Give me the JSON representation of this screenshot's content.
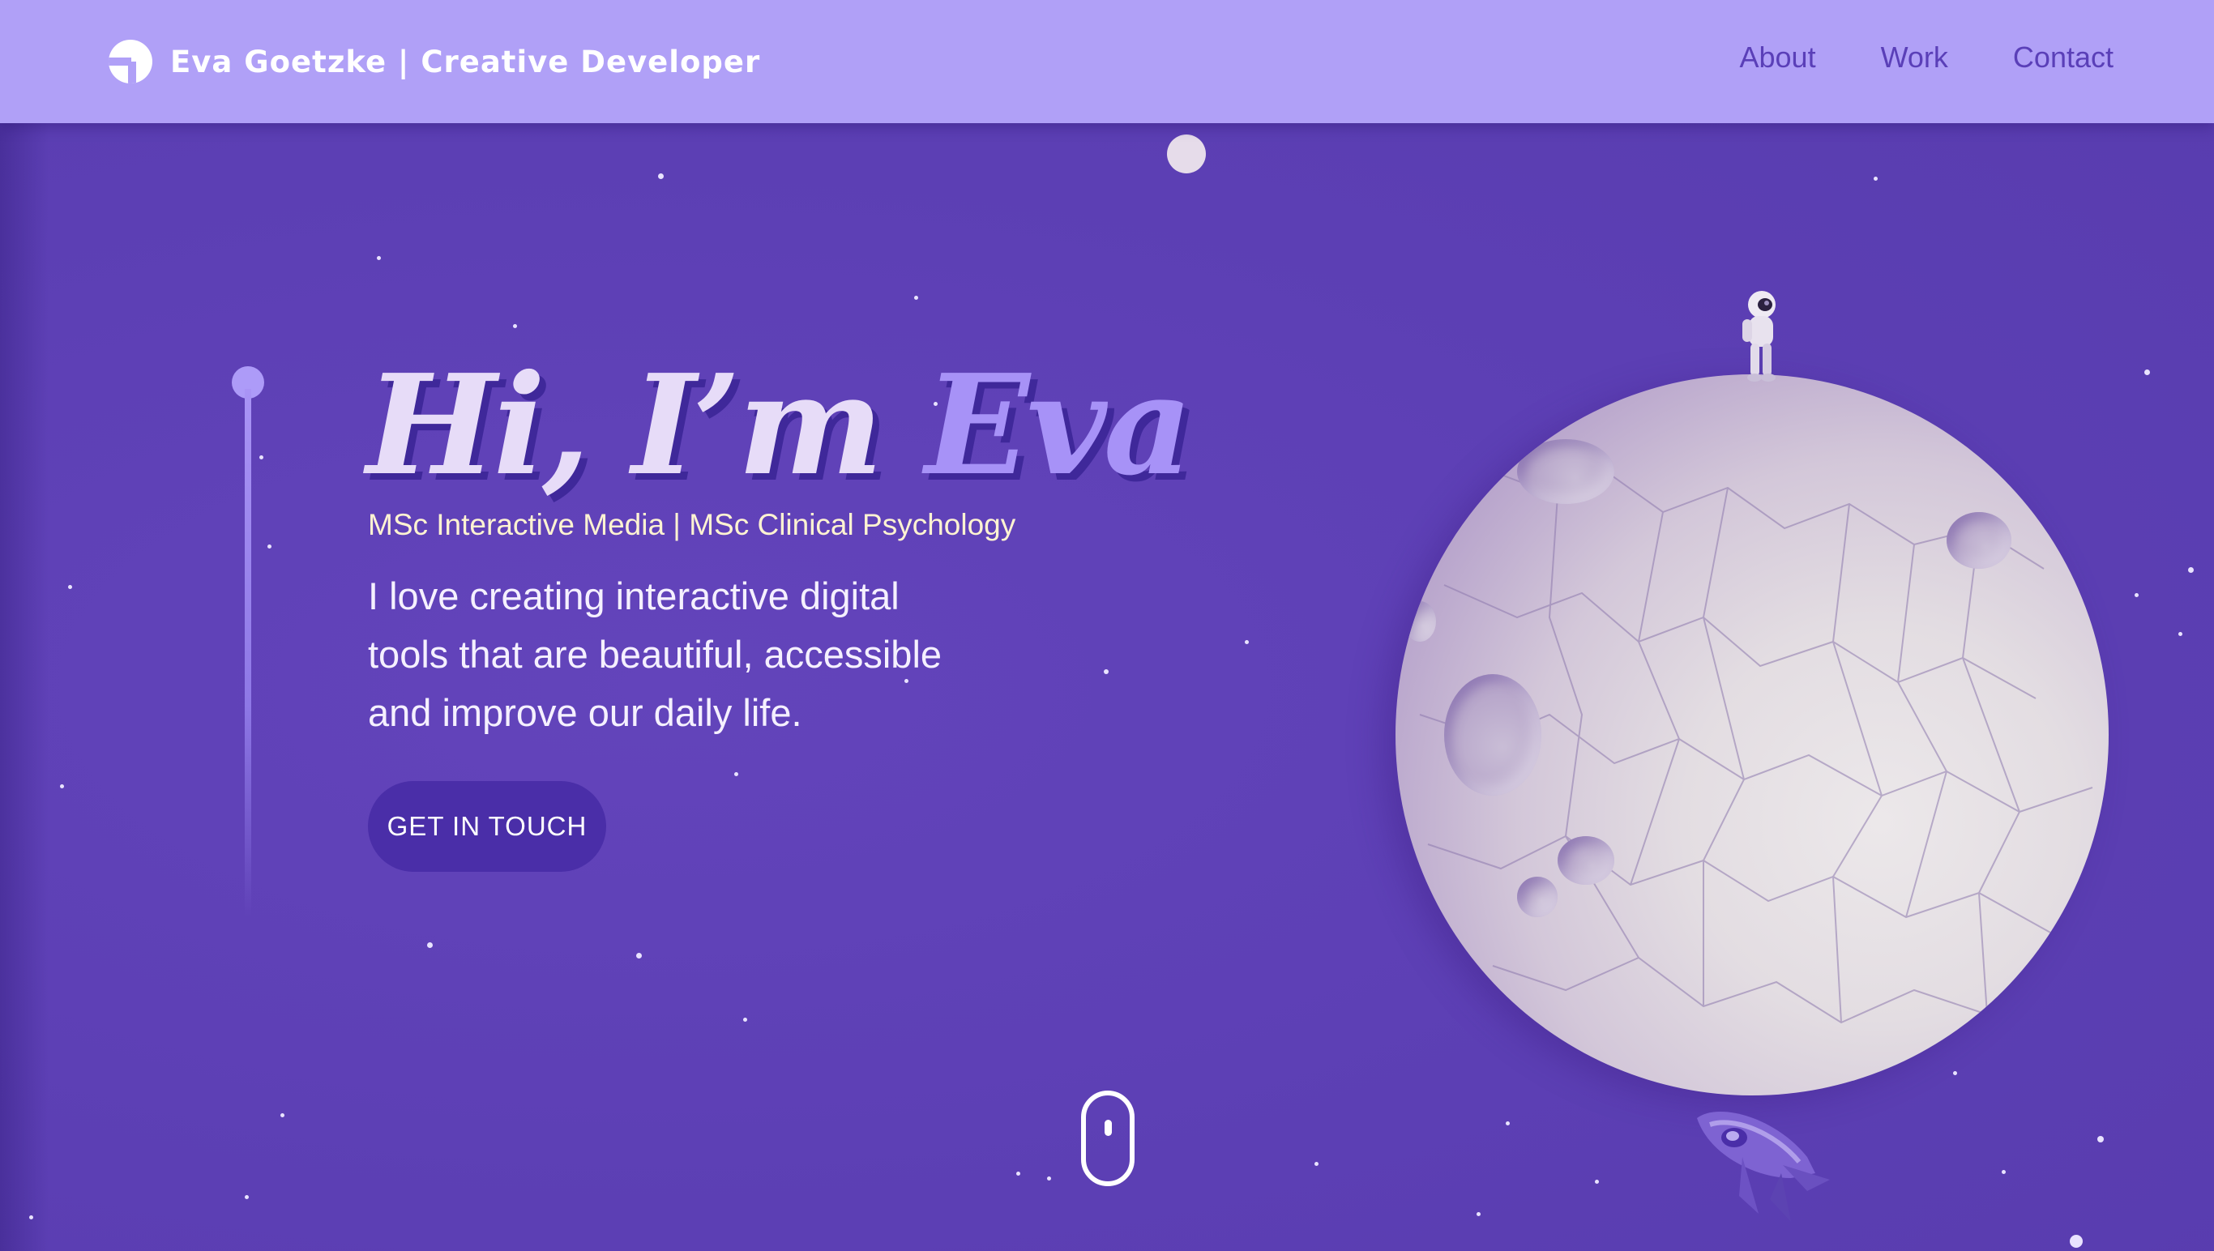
{
  "header": {
    "brand_name": "Eva Goetzke | Creative Developer",
    "logo_icon": "logo-mark-icon",
    "nav": [
      {
        "label": "About"
      },
      {
        "label": "Work"
      },
      {
        "label": "Contact"
      }
    ]
  },
  "hero": {
    "greeting": "Hi, I’m",
    "name": "Eva",
    "subtitle": "MSc Interactive Media | MSc Clinical Psychology",
    "body": "I love creating interactive digital tools that are beautiful, accessible and improve our daily life.",
    "cta_label": "GET IN TOUCH"
  },
  "scroll_indicator": {
    "icon": "mouse-scroll-icon"
  },
  "illustration": {
    "moon_icon": "moon-illustration",
    "astronaut_icon": "astronaut-illustration",
    "rocket_icon": "rocket-illustration"
  },
  "colors": {
    "background": "#5e40b5",
    "header": "#b0a0f7",
    "nav_link": "#5a3fb8",
    "accent": "#a792f7",
    "cta": "#4a2ea8",
    "subtitle": "#fff3d2"
  }
}
